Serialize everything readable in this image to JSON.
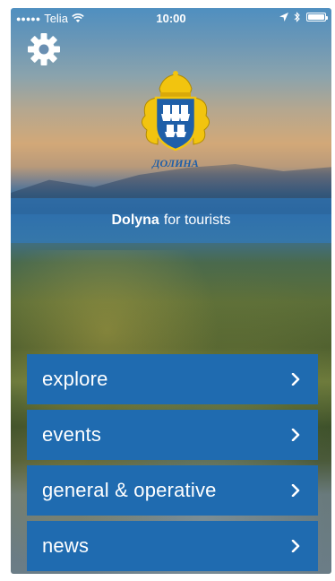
{
  "status_bar": {
    "carrier": "Telia",
    "signal_dots": "●●●●●",
    "time": "10:00"
  },
  "header": {
    "settings_icon": "gear-icon",
    "logo_text": "ДОЛИНА"
  },
  "title": {
    "bold": "Dolyna",
    "rest": "for tourists"
  },
  "menu": {
    "items": [
      {
        "label": "explore"
      },
      {
        "label": "events"
      },
      {
        "label": "general & operative"
      },
      {
        "label": "news"
      }
    ]
  },
  "colors": {
    "menu_bg": "#1f6bb0",
    "title_band": "#2d7dc8",
    "logo_gold": "#f2c40f",
    "logo_blue": "#1f5fa8"
  }
}
